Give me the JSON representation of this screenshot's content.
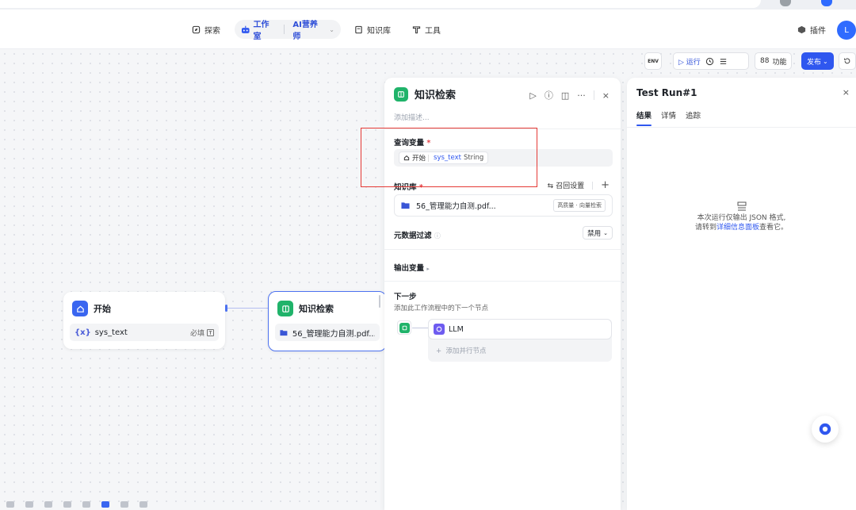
{
  "nav": {
    "explore": "探索",
    "workspace": "工作室",
    "project": "AI营养师",
    "knowledge": "知识库",
    "tools": "工具",
    "plugin": "插件",
    "avatar": "L"
  },
  "toolbar": {
    "env": "ENV",
    "run": "运行",
    "features": "功能",
    "publish": "发布"
  },
  "canvas": {
    "start_node": {
      "title": "开始",
      "var_prefix": "{x}",
      "var_name": "sys_text",
      "required": "必填"
    },
    "knowledge_node": {
      "title": "知识检索",
      "file": "56_管理能力自测.pdf..."
    }
  },
  "panel": {
    "title": "知识检索",
    "desc_placeholder": "添加描述...",
    "query_label": "查询变量",
    "query_chip_node": "开始",
    "query_chip_var": "sys_text",
    "query_chip_type": "String",
    "kb_label": "知识库",
    "recall_settings": "召回设置",
    "kb_file": "56_管理能力自测.pdf...",
    "kb_tag": "高质量 · 向量检索",
    "metadata_label": "元数据过滤",
    "metadata_value": "禁用",
    "output_label": "输出变量",
    "next_label": "下一步",
    "next_desc": "添加此工作流程中的下一个节点",
    "next_node": "LLM",
    "add_parallel": "添加并行节点"
  },
  "testrun": {
    "title": "Test Run#1",
    "tabs": [
      "结果",
      "详情",
      "追踪"
    ],
    "empty_line1": "本次运行仅输出 JSON 格式,",
    "empty_line2_prefix": "请转到",
    "empty_link": "详细信息面板",
    "empty_line2_suffix": "查看它。"
  },
  "colors": {
    "accent": "#2f57ef",
    "start_icon": "#3a66f0",
    "knowledge_icon": "#20b36a",
    "highlight_box": "#e53935"
  }
}
